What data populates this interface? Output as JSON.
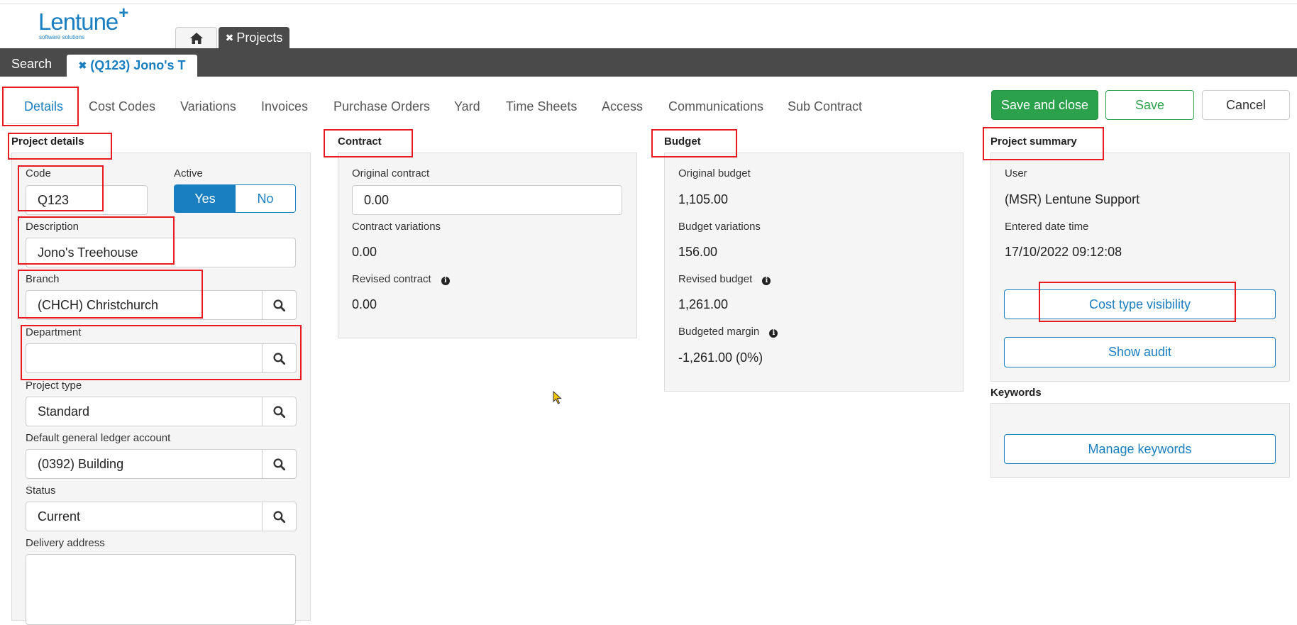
{
  "app": {
    "logo_text": "Lentune",
    "logo_plus": "+",
    "logo_sub": "software solutions"
  },
  "app_tabs": {
    "projects_label": "Projects",
    "close_glyph": "✖"
  },
  "window_tabs": {
    "search_label": "Search",
    "project_tab_label": "(Q123) Jono's T",
    "close_glyph": "✖"
  },
  "nav_tabs": [
    "Details",
    "Cost Codes",
    "Variations",
    "Invoices",
    "Purchase Orders",
    "Yard",
    "Time Sheets",
    "Access",
    "Communications",
    "Sub Contract"
  ],
  "actions": {
    "save_and_close": "Save and close",
    "save": "Save",
    "cancel": "Cancel"
  },
  "project_details": {
    "title": "Project details",
    "code_label": "Code",
    "code_value": "Q123",
    "active_label": "Active",
    "active_yes": "Yes",
    "active_no": "No",
    "description_label": "Description",
    "description_value": "Jono's Treehouse",
    "branch_label": "Branch",
    "branch_value": "(CHCH) Christchurch",
    "department_label": "Department",
    "department_value": "",
    "project_type_label": "Project type",
    "project_type_value": "Standard",
    "gl_label": "Default general ledger account",
    "gl_value": "(0392) Building",
    "status_label": "Status",
    "status_value": "Current",
    "delivery_label": "Delivery address"
  },
  "contract": {
    "title": "Contract",
    "original_label": "Original contract",
    "original_value": "0.00",
    "variations_label": "Contract variations",
    "variations_value": "0.00",
    "revised_label": "Revised contract",
    "revised_value": "0.00"
  },
  "budget": {
    "title": "Budget",
    "original_label": "Original budget",
    "original_value": "1,105.00",
    "variations_label": "Budget variations",
    "variations_value": "156.00",
    "revised_label": "Revised budget",
    "revised_value": "1,261.00",
    "margin_label": "Budgeted margin",
    "margin_value": "-1,261.00 (0%)"
  },
  "summary": {
    "title": "Project summary",
    "user_label": "User",
    "user_value": "(MSR) Lentune Support",
    "entered_label": "Entered date time",
    "entered_value": "17/10/2022 09:12:08",
    "cost_type_button": "Cost type visibility",
    "show_audit_button": "Show audit"
  },
  "keywords": {
    "title": "Keywords",
    "manage_button": "Manage keywords"
  },
  "colors": {
    "brand_blue": "#1a7fc1",
    "green": "#2aa14a",
    "dark_bar": "#4a4a4a",
    "highlight_red": "#e8191f"
  },
  "icons": {
    "home": "home-icon",
    "search": "search-icon",
    "info": "info-icon",
    "cursor": "mouse-cursor-icon"
  }
}
